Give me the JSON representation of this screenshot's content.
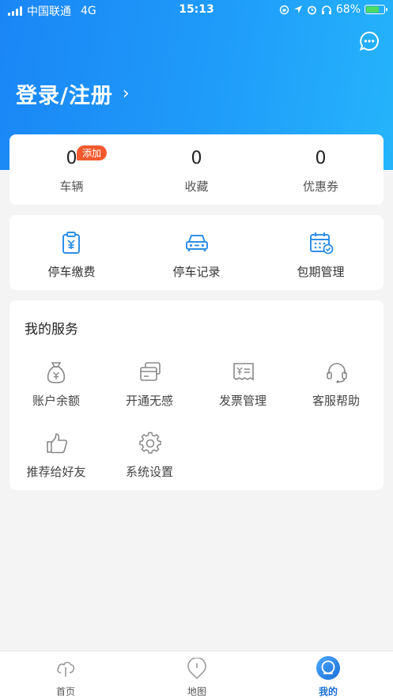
{
  "status_bar": {
    "carrier": "中国联通",
    "network": "4G",
    "time": "15:13",
    "battery": "68%"
  },
  "header": {
    "login_label": "登录/注册",
    "login_chevron": "›",
    "message_icon": "chat-bubble-icon"
  },
  "stats": [
    {
      "value": "0",
      "label": "车辆",
      "badge": "添加"
    },
    {
      "value": "0",
      "label": "收藏"
    },
    {
      "value": "0",
      "label": "优惠券"
    }
  ],
  "quick_actions": [
    {
      "label": "停车缴费",
      "icon": "payment-clipboard-icon"
    },
    {
      "label": "停车记录",
      "icon": "car-icon"
    },
    {
      "label": "包期管理",
      "icon": "calendar-check-icon"
    }
  ],
  "services": {
    "title": "我的服务",
    "items": [
      {
        "label": "账户余额",
        "icon": "money-bag-icon"
      },
      {
        "label": "开通无感",
        "icon": "cards-icon"
      },
      {
        "label": "发票管理",
        "icon": "invoice-icon"
      },
      {
        "label": "客服帮助",
        "icon": "headset-icon"
      },
      {
        "label": "推荐给好友",
        "icon": "thumbs-up-icon"
      },
      {
        "label": "系统设置",
        "icon": "gear-icon"
      }
    ]
  },
  "tabbar": [
    {
      "label": "首页",
      "icon": "home-cloud-icon"
    },
    {
      "label": "地图",
      "icon": "map-pin-icon"
    },
    {
      "label": "我的",
      "icon": "profile-icon",
      "active": true
    }
  ],
  "colors": {
    "brand_blue": "#1a86f5",
    "accent_icon_blue": "#2f8fe6",
    "badge_orange": "#f25a2e",
    "active_tab": "#1a6fd6"
  }
}
